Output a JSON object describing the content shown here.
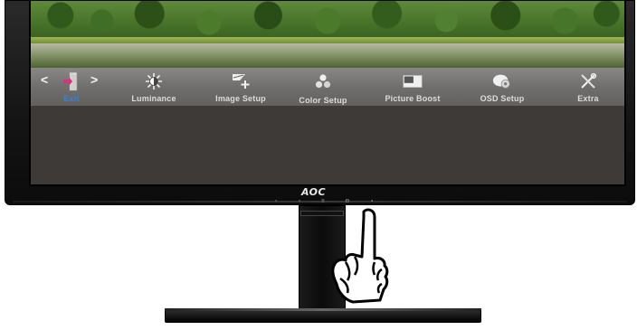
{
  "osd": {
    "items": [
      {
        "label": "Exit",
        "icon": "exit-icon",
        "active": true
      },
      {
        "label": "Luminance",
        "icon": "luminance-icon"
      },
      {
        "label": "Image Setup",
        "icon": "image-setup-icon"
      },
      {
        "label": "Color Setup",
        "icon": "color-setup-icon"
      },
      {
        "label": "Picture Boost",
        "icon": "picture-boost-icon"
      },
      {
        "label": "OSD Setup",
        "icon": "osd-setup-icon"
      },
      {
        "label": "Extra",
        "icon": "extra-icon"
      }
    ],
    "nav_left": "<",
    "nav_right": ">",
    "active_color": "#2e86d6"
  },
  "monitor": {
    "logo": "AOC",
    "buttons": [
      "‹",
      "›",
      "≡",
      "◘",
      "▪"
    ]
  }
}
